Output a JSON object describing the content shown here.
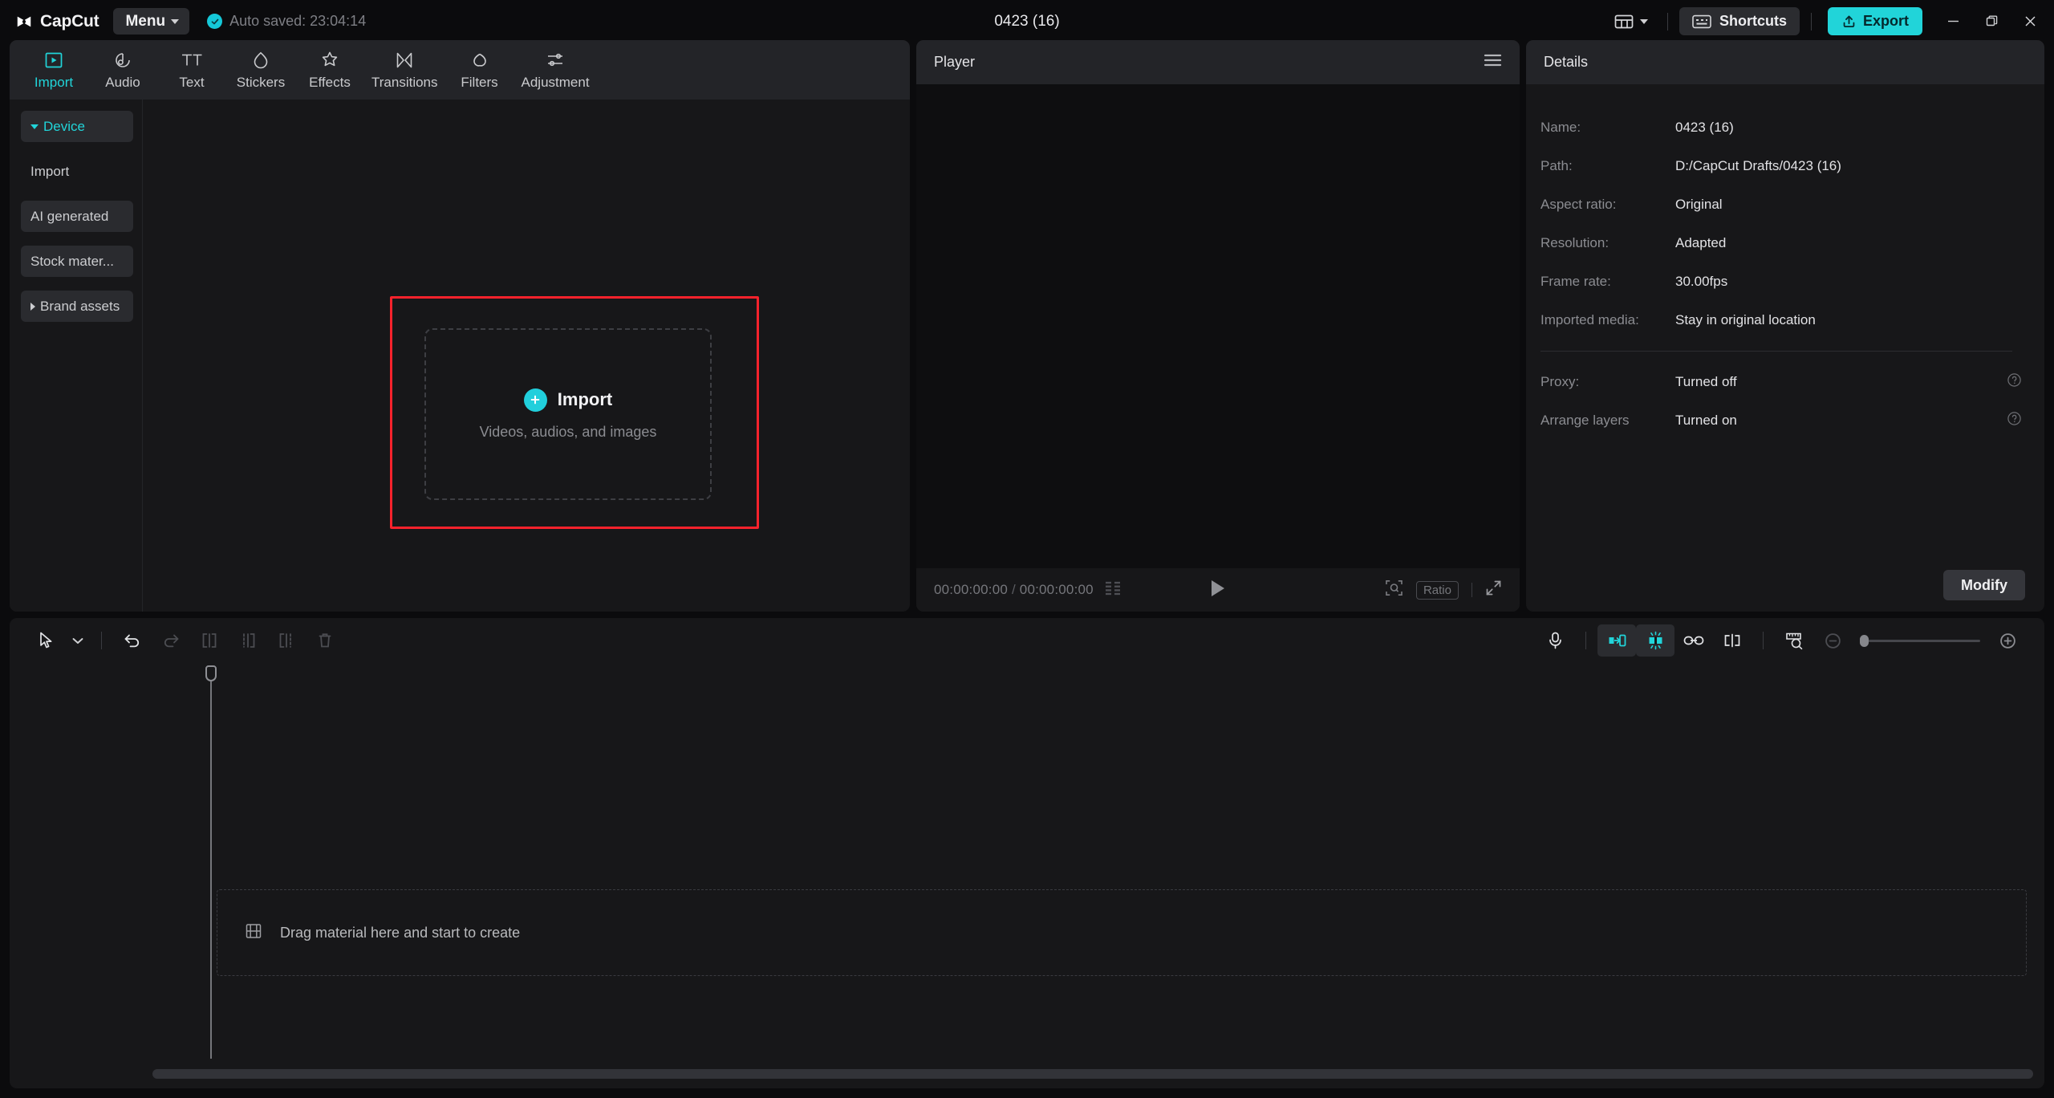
{
  "titlebar": {
    "brand": "CapCut",
    "menu_label": "Menu",
    "autosave_text": "Auto saved: 23:04:14",
    "document_title": "0423 (16)",
    "shortcuts_label": "Shortcuts",
    "export_label": "Export",
    "accent_color": "#21d4d9",
    "icons": {
      "logo": "capcut-logo-icon",
      "check": "check-circle-icon",
      "layout": "layout-grid-icon",
      "chevron": "chevron-down-icon",
      "keyboard": "keyboard-icon",
      "upload": "upload-icon",
      "minimize": "minimize-icon",
      "maximize": "restore-icon",
      "close": "close-icon"
    }
  },
  "media_panel": {
    "tabs": [
      {
        "label": "Import",
        "icon": "import-frame-icon",
        "active": true
      },
      {
        "label": "Audio",
        "icon": "audio-note-icon",
        "active": false
      },
      {
        "label": "Text",
        "icon": "text-tt-icon",
        "active": false
      },
      {
        "label": "Stickers",
        "icon": "sticker-drop-icon",
        "active": false
      },
      {
        "label": "Effects",
        "icon": "effects-star-icon",
        "active": false
      },
      {
        "label": "Transitions",
        "icon": "transitions-bowtie-icon",
        "active": false
      },
      {
        "label": "Filters",
        "icon": "filters-circles-icon",
        "active": false
      },
      {
        "label": "Adjustment",
        "icon": "adjustment-sliders-icon",
        "active": false
      }
    ],
    "side_nav": [
      {
        "label": "Device",
        "active": true,
        "boxed": true,
        "caret": "down"
      },
      {
        "label": "Import",
        "active": false,
        "boxed": false,
        "caret": "none"
      },
      {
        "label": "AI generated",
        "active": false,
        "boxed": true,
        "caret": "none"
      },
      {
        "label": "Stock mater...",
        "active": false,
        "boxed": true,
        "caret": "none"
      },
      {
        "label": "Brand assets",
        "active": false,
        "boxed": true,
        "caret": "right"
      }
    ],
    "dropzone": {
      "title": "Import",
      "subtitle": "Videos, audios, and images",
      "plus_icon": "plus-circle-icon",
      "highlight_color": "#f8222c"
    }
  },
  "player": {
    "header_title": "Player",
    "menu_icon": "hamburger-menu-icon",
    "current_time": "00:00:00:00",
    "time_separator": "/",
    "total_time": "00:00:00:00",
    "grid_icon": "grid-frames-icon",
    "play_icon": "play-icon",
    "zoom_fit_icon": "zoom-fit-icon",
    "ratio_label": "Ratio",
    "fullscreen_icon": "fullscreen-icon"
  },
  "details": {
    "header_title": "Details",
    "rows": [
      {
        "label": "Name:",
        "value": "0423 (16)",
        "help": false
      },
      {
        "label": "Path:",
        "value": "D:/CapCut Drafts/0423 (16)",
        "help": false
      },
      {
        "label": "Aspect ratio:",
        "value": "Original",
        "help": false
      },
      {
        "label": "Resolution:",
        "value": "Adapted",
        "help": false
      },
      {
        "label": "Frame rate:",
        "value": "30.00fps",
        "help": false
      },
      {
        "label": "Imported media:",
        "value": "Stay in original location",
        "help": false
      }
    ],
    "rows_secondary": [
      {
        "label": "Proxy:",
        "value": "Turned off",
        "help": true
      },
      {
        "label": "Arrange layers",
        "value": "Turned on",
        "help": true
      }
    ],
    "modify_label": "Modify",
    "help_icon": "question-circle-icon"
  },
  "timeline": {
    "left_tools": [
      {
        "icon": "select-cursor-icon",
        "active": false,
        "enabled": true
      },
      {
        "icon": "chevron-down-icon",
        "active": false,
        "enabled": true
      },
      {
        "icon": "undo-icon",
        "active": false,
        "enabled": true
      },
      {
        "icon": "redo-icon",
        "active": false,
        "enabled": false
      },
      {
        "icon": "split-icon",
        "active": false,
        "enabled": false
      },
      {
        "icon": "trim-left-icon",
        "active": false,
        "enabled": false
      },
      {
        "icon": "trim-right-icon",
        "active": false,
        "enabled": false
      },
      {
        "icon": "delete-icon",
        "active": false,
        "enabled": false
      }
    ],
    "right_tools": [
      {
        "icon": "microphone-icon",
        "active": false,
        "enabled": true
      },
      {
        "icon": "snap-to-edge-icon",
        "active": true,
        "enabled": true
      },
      {
        "icon": "magnetic-snap-icon",
        "active": true,
        "enabled": true
      },
      {
        "icon": "link-icon",
        "active": false,
        "enabled": true
      },
      {
        "icon": "split-view-icon",
        "active": false,
        "enabled": true
      },
      {
        "icon": "ruler-preview-icon",
        "active": false,
        "enabled": true
      },
      {
        "icon": "zoom-out-icon",
        "active": false,
        "enabled": false
      },
      {
        "icon": "zoom-in-icon",
        "active": false,
        "enabled": true
      }
    ],
    "empty_state": "Drag material here and start to create",
    "empty_state_icon": "film-strip-icon",
    "zoom_value": 0
  }
}
